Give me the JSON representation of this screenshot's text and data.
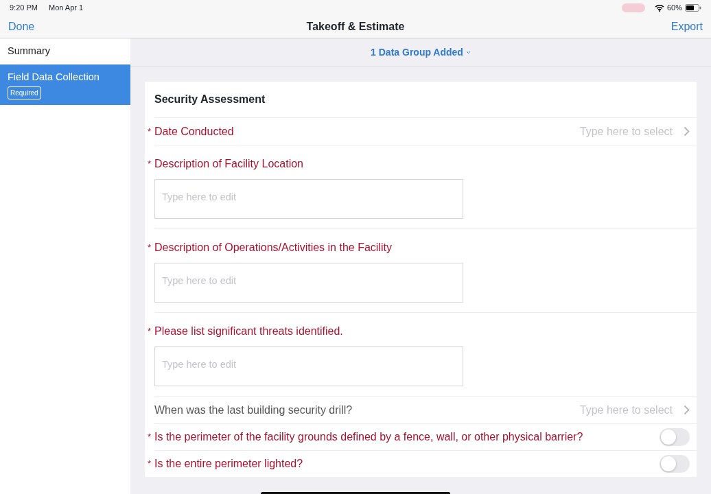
{
  "status_bar": {
    "time": "9:20 PM",
    "date": "Mon Apr 1",
    "battery_percent": "60%"
  },
  "nav_bar": {
    "left_button": "Done",
    "title": "Takeoff & Estimate",
    "right_button": "Export"
  },
  "sidebar": {
    "items": [
      {
        "label": "Summary",
        "selected": false
      },
      {
        "label": "Field Data Collection",
        "badge": "Required",
        "selected": true
      }
    ]
  },
  "group_selector": {
    "label": "1 Data Group Added"
  },
  "form": {
    "title": "Security Assessment",
    "fields": [
      {
        "kind": "select",
        "label": "Date Conducted",
        "required": true,
        "mark": "*",
        "placeholder": "Type here to select"
      },
      {
        "kind": "textarea",
        "label": "Description of Facility Location",
        "required": true,
        "mark": "*",
        "placeholder": "Type here to edit"
      },
      {
        "kind": "textarea",
        "label": "Description of Operations/Activities in the Facility",
        "required": true,
        "mark": "*",
        "placeholder": "Type here to edit"
      },
      {
        "kind": "textarea",
        "label": "Please list significant threats identified.",
        "required": true,
        "mark": "*",
        "placeholder": "Type here to edit"
      },
      {
        "kind": "select",
        "label": "When was the last building security drill?",
        "required": false,
        "placeholder": "Type here to select"
      },
      {
        "kind": "toggle",
        "label": "Is the perimeter of the facility grounds defined by a fence, wall, or other physical barrier?",
        "required": true,
        "mark": "*",
        "on": false
      },
      {
        "kind": "toggle",
        "label": "Is the entire perimeter lighted?",
        "required": true,
        "mark": "*",
        "on": false
      }
    ]
  }
}
